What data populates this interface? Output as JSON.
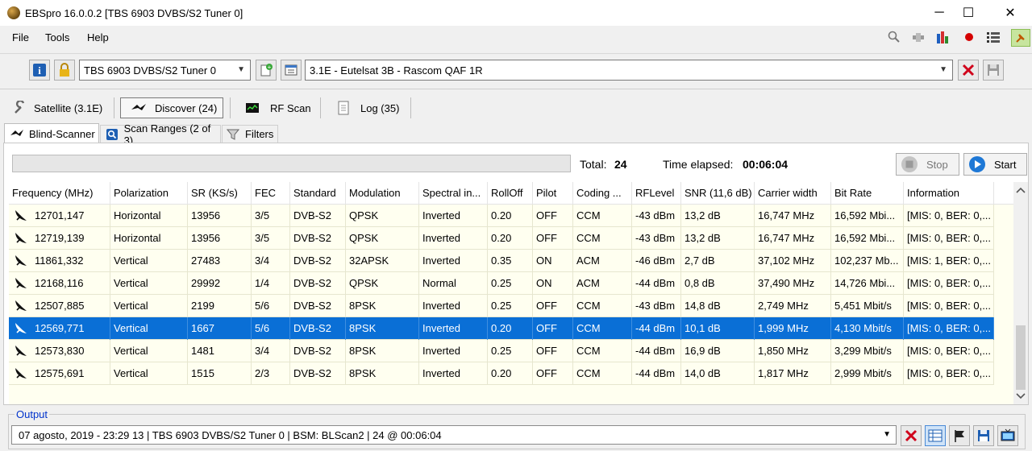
{
  "window": {
    "title": "EBSpro 16.0.0.2 [TBS 6903 DVBS/S2 Tuner 0]",
    "minimize": "─",
    "maximize": "☐",
    "close": "✕"
  },
  "menu": [
    "File",
    "Tools",
    "Help"
  ],
  "menu_icons": [
    "magnifier-icon",
    "satellite-icon",
    "bar-chart-icon",
    "record-icon",
    "list-icon",
    "pin-icon"
  ],
  "toolbar": {
    "tuner": "TBS 6903 DVBS/S2 Tuner 0",
    "satellite": "3.1E - Eutelsat 3B - Rascom QAF 1R"
  },
  "tabs": [
    {
      "label": "Satellite (3.1E)",
      "icon": "wrench-icon"
    },
    {
      "label": "Discover (24)",
      "icon": "satellite-icon"
    },
    {
      "label": "RF Scan",
      "icon": "monitor-icon"
    },
    {
      "label": "Log (35)",
      "icon": "document-icon"
    }
  ],
  "subtabs": [
    {
      "label": "Blind-Scanner",
      "icon": "satellite-icon"
    },
    {
      "label": "Scan Ranges (2 of 3)",
      "icon": "search-box-icon"
    },
    {
      "label": "Filters",
      "icon": "filter-icon"
    }
  ],
  "status": {
    "total_label": "Total:",
    "total_value": "24",
    "elapsed_label": "Time elapsed:",
    "elapsed_value": "00:06:04",
    "progress": 0
  },
  "buttons": {
    "stop": "Stop",
    "start": "Start"
  },
  "table": {
    "columns": [
      "Frequency (MHz)",
      "Polarization",
      "SR (KS/s)",
      "FEC",
      "Standard",
      "Modulation",
      "Spectral in...",
      "RollOff",
      "Pilot",
      "Coding ...",
      "RFLevel",
      "SNR (11,6 dB)",
      "Carrier width",
      "Bit Rate",
      "Information"
    ],
    "rows": [
      [
        "12701,147",
        "Horizontal",
        "13956",
        "3/5",
        "DVB-S2",
        "QPSK",
        "Inverted",
        "0.20",
        "OFF",
        "CCM",
        "-43 dBm",
        "13,2 dB",
        "16,747 MHz",
        "16,592 Mbi...",
        "[MIS: 0, BER: 0,..."
      ],
      [
        "12719,139",
        "Horizontal",
        "13956",
        "3/5",
        "DVB-S2",
        "QPSK",
        "Inverted",
        "0.20",
        "OFF",
        "CCM",
        "-43 dBm",
        "13,2 dB",
        "16,747 MHz",
        "16,592 Mbi...",
        "[MIS: 0, BER: 0,..."
      ],
      [
        "11861,332",
        "Vertical",
        "27483",
        "3/4",
        "DVB-S2",
        "32APSK",
        "Inverted",
        "0.35",
        "ON",
        "ACM",
        "-46 dBm",
        "2,7 dB",
        "37,102 MHz",
        "102,237 Mb...",
        "[MIS: 1, BER: 0,..."
      ],
      [
        "12168,116",
        "Vertical",
        "29992",
        "1/4",
        "DVB-S2",
        "QPSK",
        "Normal",
        "0.25",
        "ON",
        "ACM",
        "-44 dBm",
        "0,8 dB",
        "37,490 MHz",
        "14,726 Mbi...",
        "[MIS: 0, BER: 0,..."
      ],
      [
        "12507,885",
        "Vertical",
        "2199",
        "5/6",
        "DVB-S2",
        "8PSK",
        "Inverted",
        "0.25",
        "OFF",
        "CCM",
        "-43 dBm",
        "14,8 dB",
        "2,749 MHz",
        "5,451 Mbit/s",
        "[MIS: 0, BER: 0,..."
      ],
      [
        "12569,771",
        "Vertical",
        "1667",
        "5/6",
        "DVB-S2",
        "8PSK",
        "Inverted",
        "0.20",
        "OFF",
        "CCM",
        "-44 dBm",
        "10,1 dB",
        "1,999 MHz",
        "4,130 Mbit/s",
        "[MIS: 0, BER: 0,..."
      ],
      [
        "12573,830",
        "Vertical",
        "1481",
        "3/4",
        "DVB-S2",
        "8PSK",
        "Inverted",
        "0.25",
        "OFF",
        "CCM",
        "-44 dBm",
        "16,9 dB",
        "1,850 MHz",
        "3,299 Mbit/s",
        "[MIS: 0, BER: 0,..."
      ],
      [
        "12575,691",
        "Vertical",
        "1515",
        "2/3",
        "DVB-S2",
        "8PSK",
        "Inverted",
        "0.20",
        "OFF",
        "CCM",
        "-44 dBm",
        "14,0 dB",
        "1,817 MHz",
        "2,999 Mbit/s",
        "[MIS: 0, BER: 0,..."
      ]
    ],
    "selected_index": 5
  },
  "output": {
    "label": "Output",
    "text": "07 agosto, 2019 - 23:29 13 | TBS 6903 DVBS/S2 Tuner 0 | BSM: BLScan2 | 24 @ 00:06:04"
  },
  "colors": {
    "selection": "#0a6fd6",
    "row_bg": "#fffff0",
    "output_label": "#0033cc",
    "stop_red": "#d0021b"
  }
}
